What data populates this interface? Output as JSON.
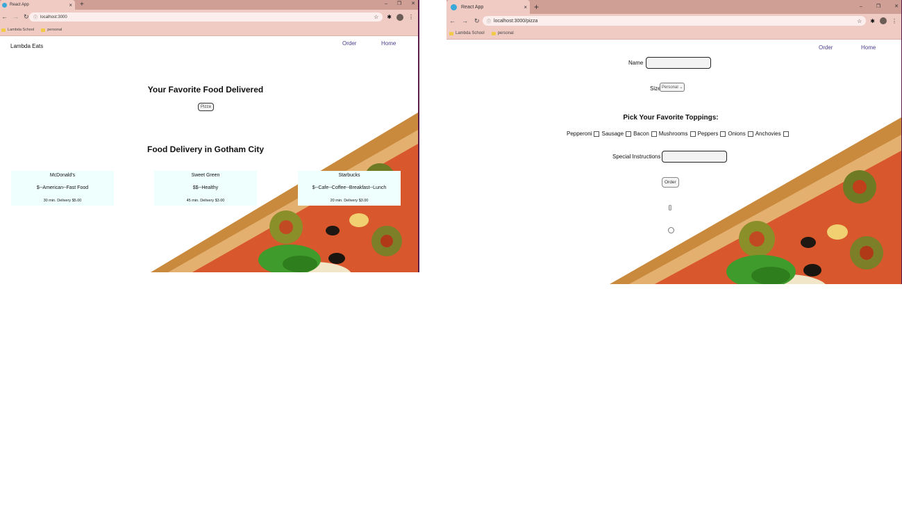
{
  "colors": {
    "accent": "#4b3a8c",
    "chrome": "#f0cbc4",
    "tabstrip": "#cf9e95",
    "card": "#effffd"
  },
  "left_window": {
    "tab_title": "React App",
    "tab_close": "×",
    "new_tab": "+",
    "address": "localhost:3000",
    "bookmarks": [
      "Lambda School",
      "personal"
    ],
    "brand": "Lambda Eats",
    "nav": {
      "order": "Order",
      "home": "Home"
    },
    "hero_title": "Your Favorite Food Delivered",
    "pizza_button": "Pizza",
    "section_title": "Food Delivery in Gotham City",
    "restaurants": [
      {
        "name": "McDonald's",
        "desc": "$--American--Fast Food",
        "time": "30 min. Delivery $5.00"
      },
      {
        "name": "Sweet Green",
        "desc": "$$--Healthy",
        "time": "45 min. Delivery $3.00"
      },
      {
        "name": "Starbucks",
        "desc": "$--Cafe--Coffee--Breakfast--Lunch",
        "time": "20 min. Delivery $3.00"
      }
    ]
  },
  "right_window": {
    "tab_title": "React App",
    "tab_close": "×",
    "new_tab": "+",
    "address": "localhost:3000/pizza",
    "bookmarks": [
      "Lambda School",
      "personal"
    ],
    "nav": {
      "order": "Order",
      "home": "Home"
    },
    "form": {
      "name_label": "Name",
      "size_label": "Size",
      "size_selected": "Personal",
      "toppings_title": "Pick Your Favorite Toppings:",
      "toppings": [
        "Pepperoni",
        "Sausage",
        "Bacon",
        "Mushrooms",
        "Peppers",
        "Onions",
        "Anchovies"
      ],
      "instructions_label": "Special Instructions",
      "order_button": "Order",
      "output": "[]"
    }
  },
  "icons": [
    "back-arrow-icon",
    "forward-arrow-icon",
    "reload-icon",
    "info-icon",
    "star-icon",
    "extensions-icon",
    "menu-dots-icon",
    "folder-icon",
    "react-favicon-icon"
  ]
}
